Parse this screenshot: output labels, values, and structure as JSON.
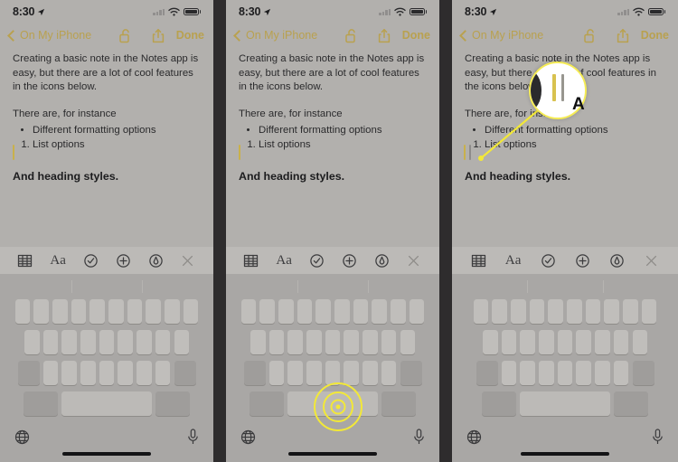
{
  "meta": {
    "panel_count": 3,
    "accent_color": "#b9a14f",
    "highlight_color": "#f2e838",
    "screen_bg": "#b2b0ad"
  },
  "status_bar": {
    "time": "8:30",
    "location_icon": "location-arrow-icon",
    "signal_icon": "cellular-signal-icon",
    "wifi_icon": "wifi-icon",
    "battery_icon": "battery-icon"
  },
  "nav_bar": {
    "back_label": "On My iPhone",
    "back_icon": "chevron-left-icon",
    "lock_icon": "unlocked-padlock-icon",
    "share_icon": "share-up-arrow-icon",
    "done_label": "Done"
  },
  "note": {
    "paragraph_1": "Creating a basic note in the Notes app is easy, but there are a lot of cool features in the icons below.",
    "paragraph_2": "There are, for instance",
    "bullet_items": [
      "Different formatting options"
    ],
    "numbered_items": [
      "List options"
    ],
    "heading": "And heading styles."
  },
  "format_toolbar": {
    "items": [
      {
        "name": "table-icon",
        "label": ""
      },
      {
        "name": "text-format-icon",
        "label": "Aa"
      },
      {
        "name": "checklist-circle-icon",
        "label": ""
      },
      {
        "name": "add-attachment-icon",
        "label": ""
      },
      {
        "name": "markup-pen-icon",
        "label": ""
      },
      {
        "name": "close-icon",
        "label": ""
      }
    ]
  },
  "keyboard": {
    "globe_icon": "globe-language-icon",
    "mic_icon": "microphone-icon",
    "home_indicator": "home-indicator-bar",
    "row1_keys": 10,
    "row2_keys": 9,
    "row3_keys": 9
  },
  "panel2": {
    "tap_indicator": "tap-target-indicator"
  },
  "panel3": {
    "magnifier": "text-cursor-magnifier-loupe",
    "magnifier_letter": "A",
    "connector": "magnifier-connector-line"
  }
}
